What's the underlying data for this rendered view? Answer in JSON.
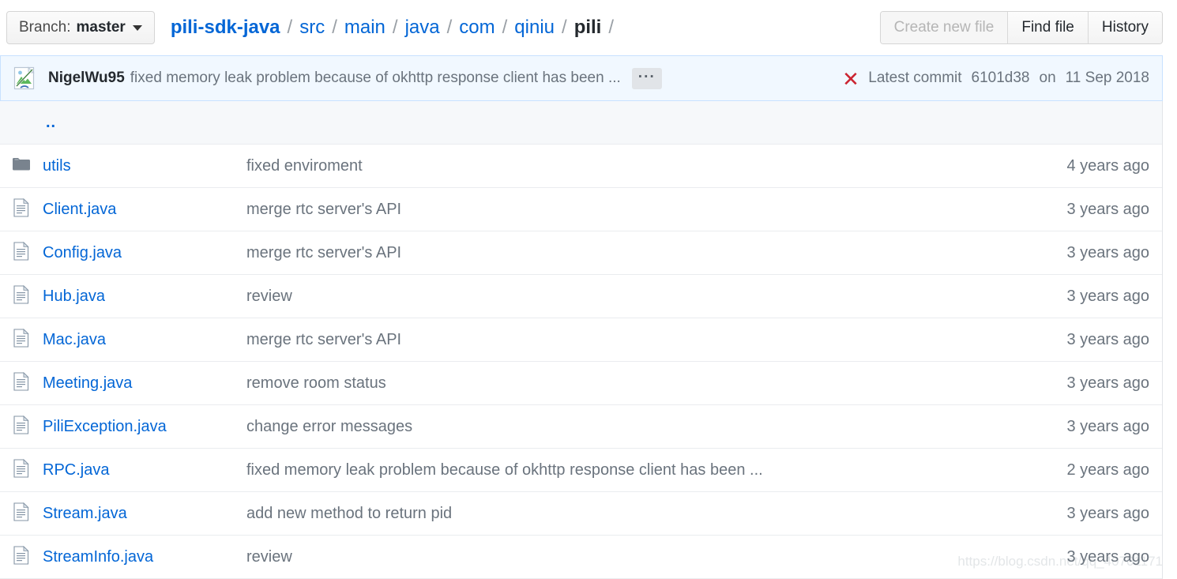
{
  "topbar": {
    "branch": {
      "label": "Branch:",
      "value": "master",
      "icon": "chevron-down-icon"
    },
    "breadcrumb": [
      {
        "text": "pili-sdk-java",
        "type": "repo"
      },
      {
        "text": "src",
        "type": "link"
      },
      {
        "text": "main",
        "type": "link"
      },
      {
        "text": "java",
        "type": "link"
      },
      {
        "text": "com",
        "type": "link"
      },
      {
        "text": "qiniu",
        "type": "link"
      },
      {
        "text": "pili",
        "type": "current"
      }
    ],
    "separator": "/",
    "actions": [
      {
        "label": "Create new file",
        "disabled": true
      },
      {
        "label": "Find file",
        "disabled": false
      },
      {
        "label": "History",
        "disabled": false
      }
    ]
  },
  "commit": {
    "avatar_icon": "broken-image-icon",
    "author": "NigelWu95",
    "message": "fixed memory leak problem because of okhttp response client has been ...",
    "expand_label": "···",
    "status_icon": "red-x-icon",
    "latest_label": "Latest commit",
    "sha": "6101d38",
    "date_prefix": "on",
    "date": "11 Sep 2018"
  },
  "files": {
    "parent_label": "..",
    "rows": [
      {
        "icon": "folder-icon",
        "name": "utils",
        "message": "fixed enviroment",
        "age": "4 years ago"
      },
      {
        "icon": "file-icon",
        "name": "Client.java",
        "message": "merge rtc server's API",
        "age": "3 years ago"
      },
      {
        "icon": "file-icon",
        "name": "Config.java",
        "message": "merge rtc server's API",
        "age": "3 years ago"
      },
      {
        "icon": "file-icon",
        "name": "Hub.java",
        "message": "review",
        "age": "3 years ago"
      },
      {
        "icon": "file-icon",
        "name": "Mac.java",
        "message": "merge rtc server's API",
        "age": "3 years ago"
      },
      {
        "icon": "file-icon",
        "name": "Meeting.java",
        "message": "remove room status",
        "age": "3 years ago"
      },
      {
        "icon": "file-icon",
        "name": "PiliException.java",
        "message": "change error messages",
        "age": "3 years ago"
      },
      {
        "icon": "file-icon",
        "name": "RPC.java",
        "message": "fixed memory leak problem because of okhttp response client has been ...",
        "age": "2 years ago"
      },
      {
        "icon": "file-icon",
        "name": "Stream.java",
        "message": "add new method to return pid",
        "age": "3 years ago"
      },
      {
        "icon": "file-icon",
        "name": "StreamInfo.java",
        "message": "review",
        "age": "3 years ago"
      }
    ]
  },
  "watermark": {
    "text": "https://blog.csdn.net/qq_40701171"
  },
  "colors": {
    "link": "#0366d6",
    "muted": "#6a737d",
    "commit_bar_bg": "#f1f8ff",
    "commit_bar_border": "#c8e1ff",
    "row_border": "#eaecef",
    "parent_row_bg": "#f6f8fa",
    "status_red": "#cb2431",
    "folder": "#79838e"
  }
}
